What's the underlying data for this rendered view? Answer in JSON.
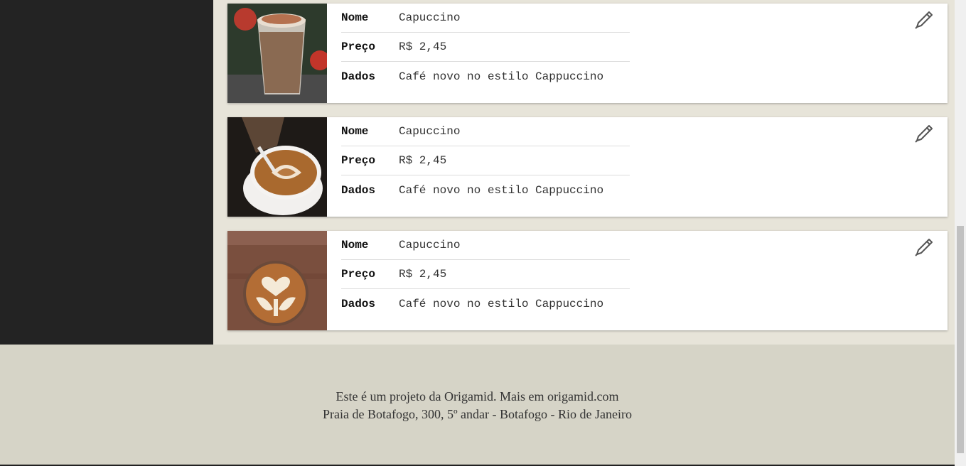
{
  "cards": [
    {
      "image": "iced-cappuccino-glass-photo",
      "fields": [
        {
          "label": "Nome",
          "value": "Capuccino"
        },
        {
          "label": "Preço",
          "value": "R$ 2,45"
        },
        {
          "label": "Dados",
          "value": "Café novo no estilo Cappuccino"
        }
      ],
      "edit_icon": "pencil-icon"
    },
    {
      "image": "latte-art-pour-photo",
      "fields": [
        {
          "label": "Nome",
          "value": "Capuccino"
        },
        {
          "label": "Preço",
          "value": "R$ 2,45"
        },
        {
          "label": "Dados",
          "value": "Café novo no estilo Cappuccino"
        }
      ],
      "edit_icon": "pencil-icon"
    },
    {
      "image": "latte-art-heart-photo",
      "fields": [
        {
          "label": "Nome",
          "value": "Capuccino"
        },
        {
          "label": "Preço",
          "value": "R$ 2,45"
        },
        {
          "label": "Dados",
          "value": "Café novo no estilo Cappuccino"
        }
      ],
      "edit_icon": "pencil-icon"
    }
  ],
  "footer": {
    "line1": "Este é um projeto da Origamid. Mais em origamid.com",
    "line2": "Praia de Botafogo, 300, 5º andar - Botafogo - Rio de Janeiro"
  },
  "colors": {
    "sidebar": "#232323",
    "content_bg": "#e7e4d9",
    "footer_bg": "#d6d4c7"
  }
}
